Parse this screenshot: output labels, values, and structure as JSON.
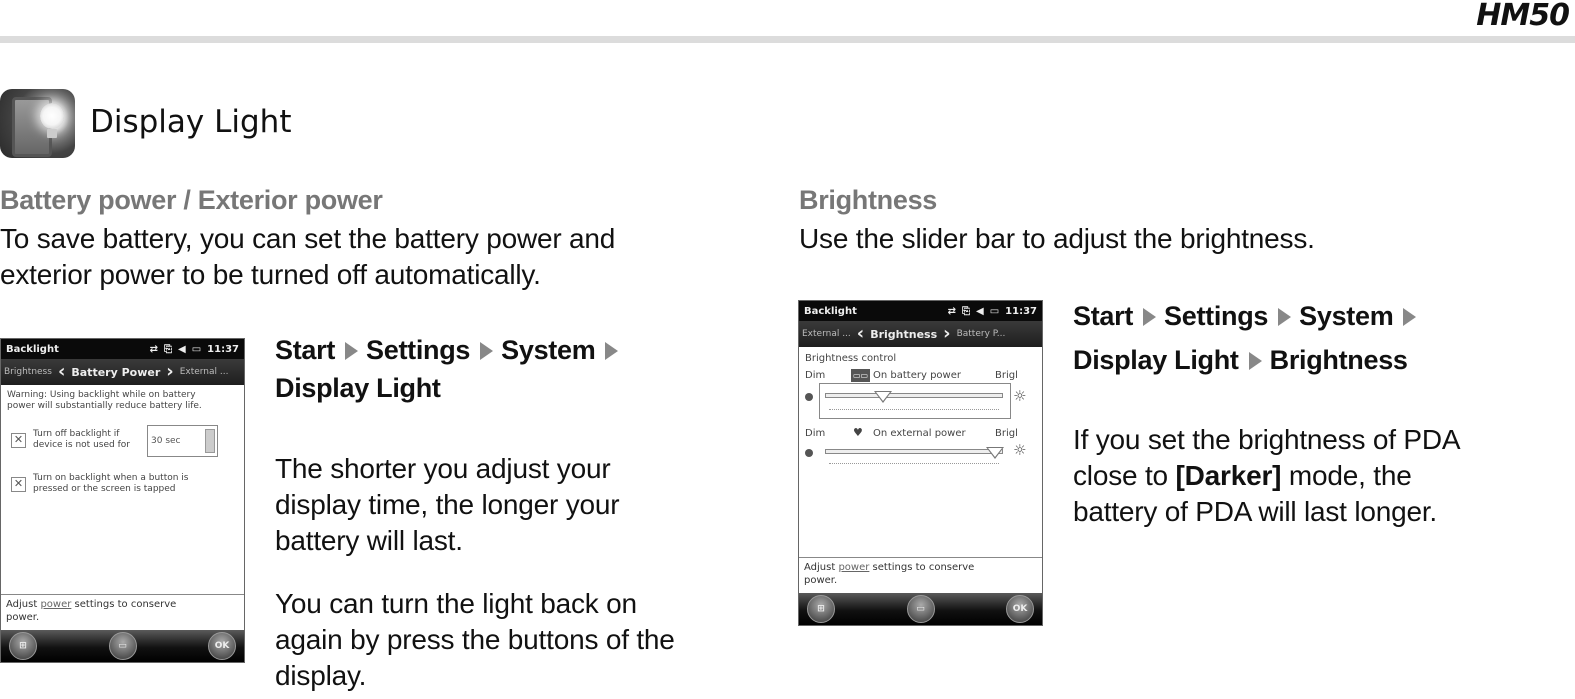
{
  "header": {
    "model": "HM50",
    "section_title": "Display Light",
    "icon": "display-light-icon"
  },
  "left": {
    "subtitle": "Battery power / Exterior power",
    "intro_lines": [
      "To save battery, you can set the battery power and",
      "exterior power to be turned off automatically."
    ],
    "nav_path": [
      "Start",
      "Settings",
      "System",
      "Display Light"
    ],
    "para1_lines": [
      "The shorter you adjust your",
      "display time, the longer your",
      "battery will last."
    ],
    "para2_lines": [
      "You can turn the light back on",
      "again by press the buttons of the",
      "display."
    ],
    "screen": {
      "title": "Backlight",
      "time": "11:37",
      "prev_tab": "Brightness",
      "current_tab": "Battery Power",
      "next_tab": "External ...",
      "warning_lines": [
        "Warning: Using backlight while on battery",
        "power will substantially reduce battery life."
      ],
      "option1_lines": [
        "Turn off backlight if",
        "device is not used for"
      ],
      "option1_checked": true,
      "timeout_value": "30 sec",
      "option2_lines": [
        "Turn on backlight when a button is",
        "pressed or the screen is tapped"
      ],
      "option2_checked": true,
      "footer_prefix": "Adjust ",
      "footer_link": "power",
      "footer_suffix": " settings to conserve",
      "footer_line2": "power.",
      "ok_label": "OK"
    }
  },
  "right": {
    "subtitle": "Brightness",
    "intro": "Use the slider bar to adjust the brightness.",
    "nav_path": [
      "Start",
      "Settings",
      "System",
      "Display Light",
      "Brightness"
    ],
    "para_line1": "If you set the brightness of PDA",
    "para_line2_prefix": "close to ",
    "para_line2_bold": "[Darker]",
    "para_line2_suffix": " mode, the",
    "para_line3": "battery of PDA will last longer.",
    "screen": {
      "title": "Backlight",
      "time": "11:37",
      "prev_tab": "External ...",
      "current_tab": "Brightness",
      "next_tab": "Battery P...",
      "group_label": "Brightness control",
      "battery": {
        "dim": "Dim",
        "label": "On battery power",
        "bright": "Brigl",
        "level": 0.33
      },
      "external": {
        "dim": "Dim",
        "label": "On external power",
        "bright": "Brigl",
        "level": 1.0
      },
      "footer_prefix": "Adjust ",
      "footer_link": "power",
      "footer_suffix": " settings to conserve",
      "footer_line2": "power.",
      "ok_label": "OK"
    }
  }
}
